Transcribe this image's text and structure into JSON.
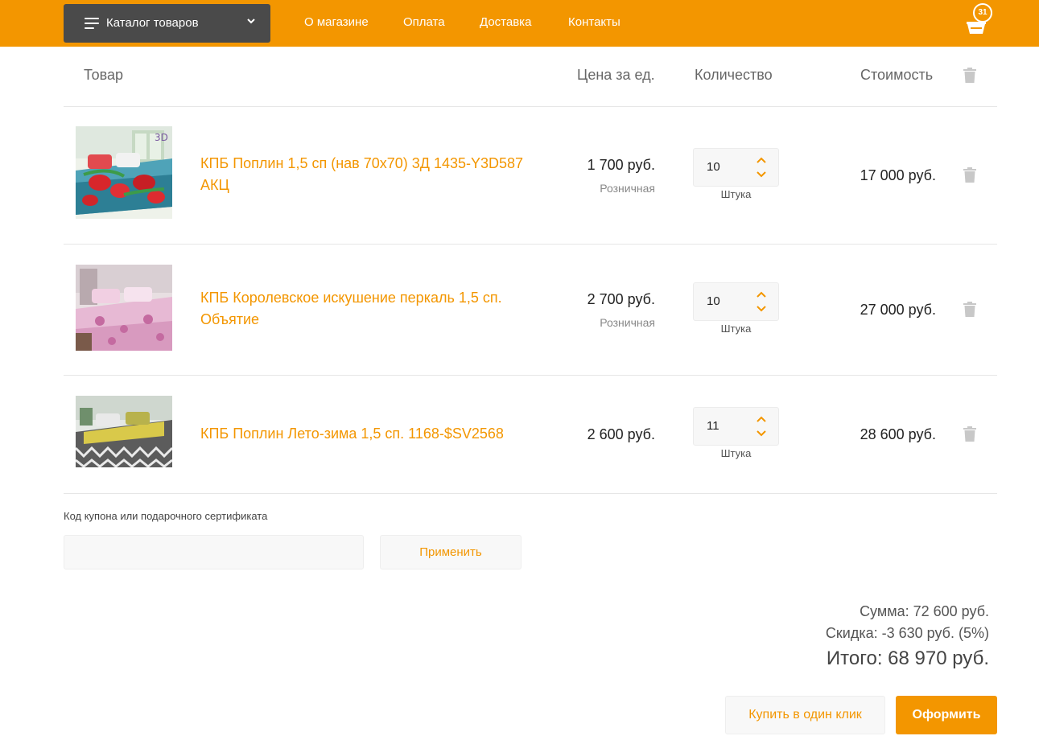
{
  "header": {
    "catalog_label": "Каталог товаров",
    "nav": [
      "О магазине",
      "Оплата",
      "Доставка",
      "Контакты"
    ],
    "cart_count": "31"
  },
  "table": {
    "col_product": "Товар",
    "col_price": "Цена за ед.",
    "col_qty": "Количество",
    "col_cost": "Стоимость"
  },
  "items": [
    {
      "name": "КПБ Поплин 1,5 сп (нав 70х70) 3Д 1435-Y3D587 АКЦ",
      "price": "1 700 руб.",
      "price_type": "Розничная",
      "qty": "10",
      "unit": "Штука",
      "cost": "17 000 руб.",
      "thumb_badge": "3D"
    },
    {
      "name": "КПБ Королевское искушение перкаль 1,5 сп. Объятие",
      "price": "2 700 руб.",
      "price_type": "Розничная",
      "qty": "10",
      "unit": "Штука",
      "cost": "27 000 руб."
    },
    {
      "name": "КПБ Поплин Лето-зима 1,5 сп. 1168-$SV2568",
      "price": "2 600 руб.",
      "qty": "11",
      "unit": "Штука",
      "cost": "28 600 руб."
    }
  ],
  "coupon": {
    "label": "Код купона или подарочного сертификата",
    "placeholder": "",
    "apply_label": "Применить"
  },
  "totals": {
    "sum": "Сумма: 72 600 руб.",
    "discount": "Скидка: -3 630 руб. (5%)",
    "total": "Итого: 68 970 руб."
  },
  "actions": {
    "one_click": "Купить в один клик",
    "checkout": "Оформить"
  },
  "colors": {
    "accent": "#f39600",
    "catalog_bg": "#4a4a4a"
  }
}
